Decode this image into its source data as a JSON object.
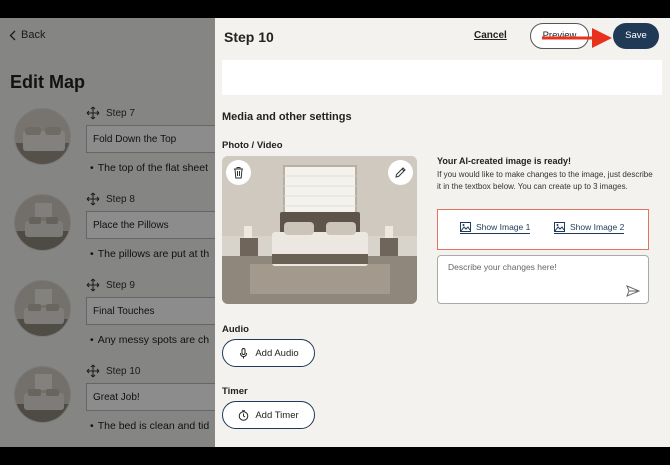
{
  "left_panel": {
    "back_label": "Back",
    "title": "Edit Map",
    "steps": [
      {
        "step_label": "Step 7",
        "title": "Fold Down the Top",
        "description": "The top of the flat sheet"
      },
      {
        "step_label": "Step 8",
        "title": "Place the Pillows",
        "description": "The pillows are put at th"
      },
      {
        "step_label": "Step 9",
        "title": "Final Touches",
        "description": "Any messy spots are ch"
      },
      {
        "step_label": "Step 10",
        "title": "Great Job!",
        "description": "The bed is clean and tid"
      }
    ]
  },
  "header": {
    "title": "Step 10",
    "cancel_label": "Cancel",
    "preview_label": "Preview",
    "save_label": "Save"
  },
  "media": {
    "section_title": "Media and other settings",
    "photo_label": "Photo / Video",
    "ai_title": "Your AI-created image is ready!",
    "ai_description": "If you would like to make changes to the image, just describe it in the textbox below. You can create up to 3 images.",
    "show_image_1": "Show Image 1",
    "show_image_2": "Show Image 2",
    "changes_placeholder": "Describe your changes here!"
  },
  "audio": {
    "label": "Audio",
    "button_label": "Add Audio"
  },
  "timer": {
    "label": "Timer",
    "button_label": "Add Timer"
  },
  "colors": {
    "primary": "#1f3957",
    "highlight_border": "#e57361",
    "arrow": "#e8321e"
  }
}
